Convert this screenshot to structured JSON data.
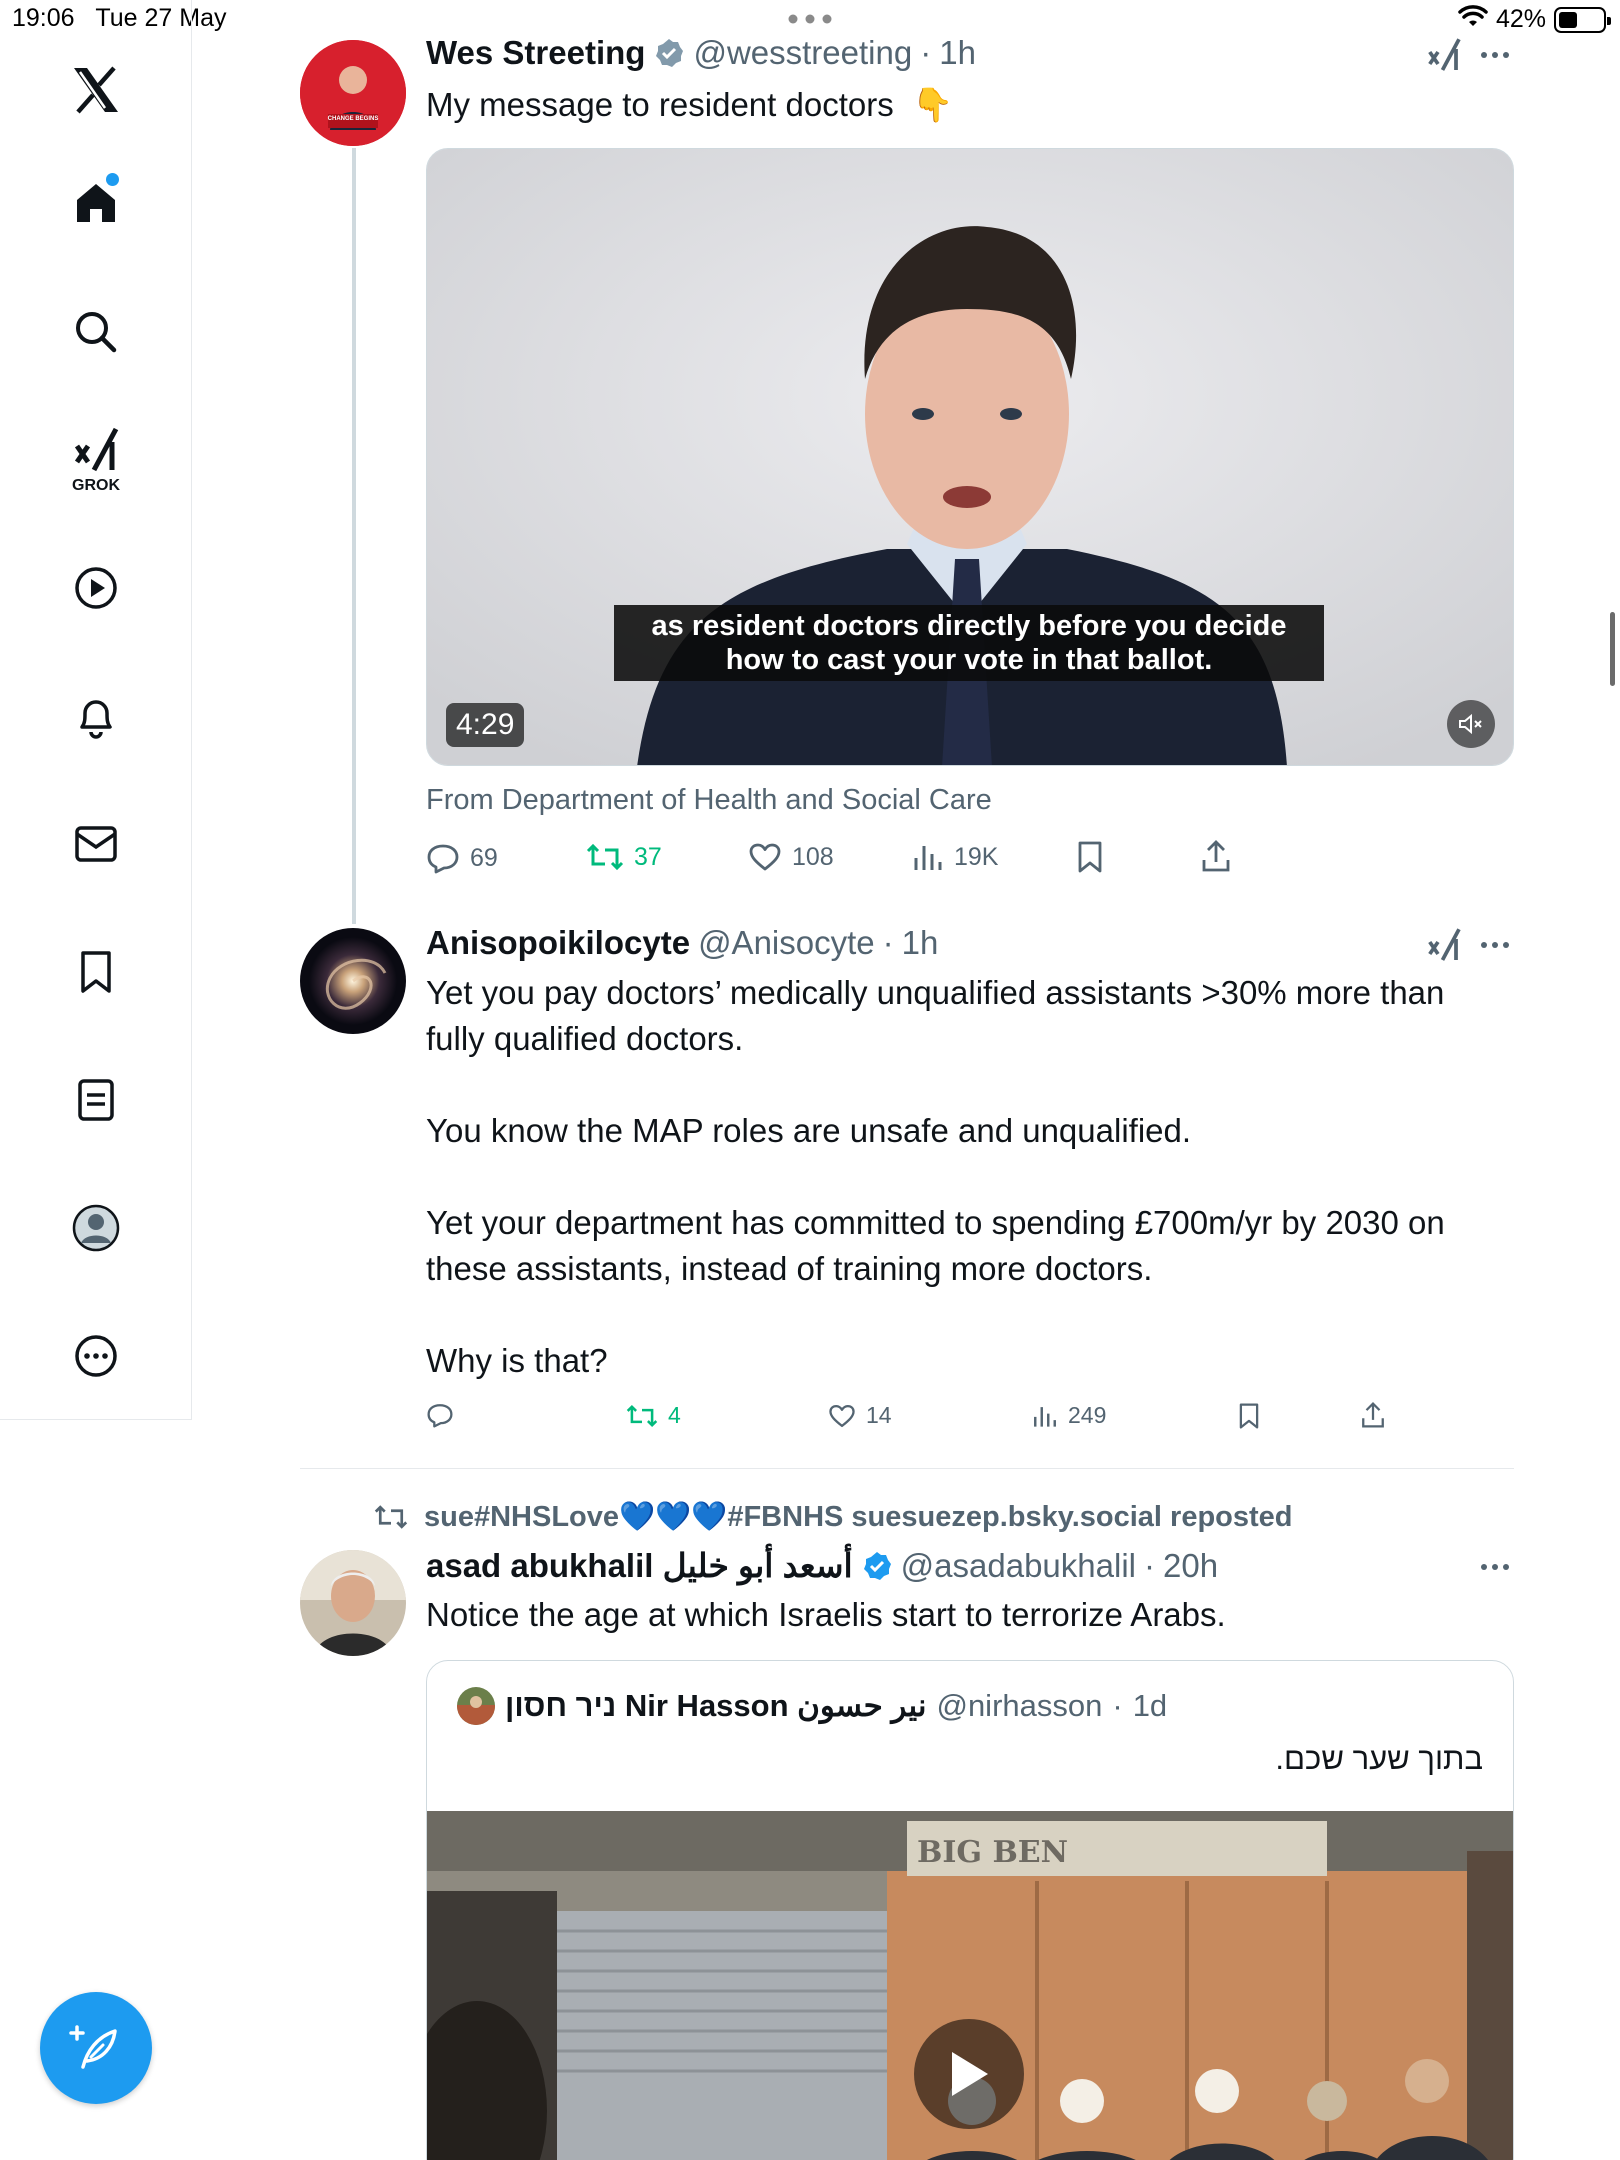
{
  "status": {
    "time": "19:06",
    "date": "Tue 27 May",
    "battery": "42%",
    "battery_level": 0.42
  },
  "sidebar": {
    "grok_label": "GROK"
  },
  "tweet1": {
    "name": "Wes Streeting",
    "handle": "@wesstreeting",
    "time": "1h",
    "text": "My message to resident doctors",
    "emoji": "👇",
    "avatar_text": "CHANGE BEGINS",
    "video": {
      "caption_line1": "as resident doctors directly before you decide",
      "caption_line2": "how to cast your vote in that ballot.",
      "duration": "4:29"
    },
    "from": "From Department of Health and Social Care",
    "stats": {
      "replies": "69",
      "reposts": "37",
      "likes": "108",
      "views": "19K"
    }
  },
  "tweet2": {
    "name": "Anisopoikilocyte",
    "handle": "@Anisocyte",
    "time": "1h",
    "p1": "Yet you pay doctors’ medically unqualified assistants >30% more than fully qualified doctors.",
    "p2": "You know the MAP roles are unsafe and unqualified.",
    "p3": "Yet your department has committed to spending £700m/yr by 2030 on these assistants, instead of training more doctors.",
    "p4": "Why is that?",
    "stats": {
      "replies": "",
      "reposts": "4",
      "likes": "14",
      "views": "249"
    }
  },
  "tweet3": {
    "reposted_by": "sue#NHSLove💙💙💙#FBNHS suesuezep.bsky.social reposted",
    "name": "asad abukhalil أسعد أبو خليل",
    "handle": "@asadabukhalil",
    "time": "20h",
    "text": "Notice the age at which Israelis start to terrorize Arabs.",
    "quote": {
      "name": "ניר חסון Nir Hasson نير حسون",
      "handle": "@nirhasson",
      "time": "1d",
      "text": "בתוך שער שכם.",
      "sign_text": "BIG BEN"
    }
  },
  "colors": {
    "accent": "#1d9bf0",
    "repost_green": "#00ba7c",
    "muted": "#536471"
  }
}
